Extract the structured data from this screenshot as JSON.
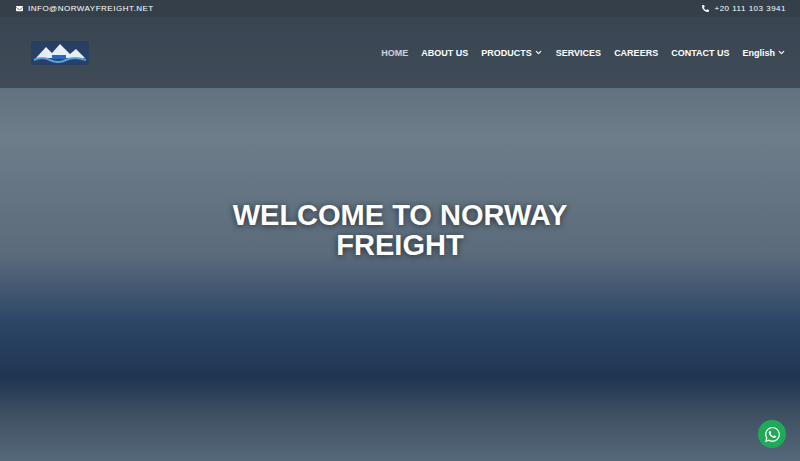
{
  "topbar": {
    "email": "INFO@NORWAYFREIGHT.NET",
    "phone": "+20 111 103 3941"
  },
  "nav": {
    "items": [
      {
        "label": "HOME",
        "selected": true,
        "dropdown": false
      },
      {
        "label": "ABOUT US",
        "selected": false,
        "dropdown": false
      },
      {
        "label": "PRODUCTS",
        "selected": false,
        "dropdown": true
      },
      {
        "label": "SERVICES",
        "selected": false,
        "dropdown": false
      },
      {
        "label": "CAREERS",
        "selected": false,
        "dropdown": false
      },
      {
        "label": "CONTACT US",
        "selected": false,
        "dropdown": false
      },
      {
        "label": "English",
        "selected": false,
        "dropdown": true
      }
    ]
  },
  "hero": {
    "title": "WELCOME TO NORWAY FREIGHT"
  }
}
